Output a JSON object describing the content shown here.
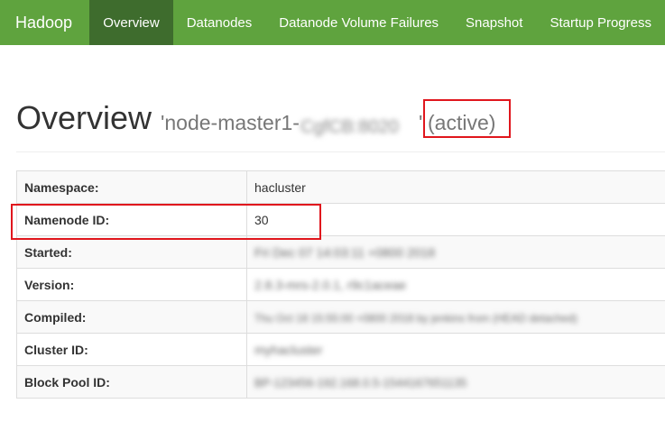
{
  "navbar": {
    "brand": "Hadoop",
    "tabs": [
      {
        "label": "Overview",
        "active": true
      },
      {
        "label": "Datanodes",
        "active": false
      },
      {
        "label": "Datanode Volume Failures",
        "active": false
      },
      {
        "label": "Snapshot",
        "active": false
      },
      {
        "label": "Startup Progress",
        "active": false
      }
    ]
  },
  "header": {
    "title": "Overview",
    "host_prefix": "'node-master1-",
    "host_redacted": "CgfCB:8020",
    "host_suffix": "'",
    "state": "(active)"
  },
  "info_table": {
    "rows": [
      {
        "key": "Namespace:",
        "value": "hacluster",
        "redacted": false
      },
      {
        "key": "Namenode ID:",
        "value": "30",
        "redacted": false
      },
      {
        "key": "Started:",
        "value": "Fri Dec 07 14:03:11 +0800 2018",
        "redacted": true
      },
      {
        "key": "Version:",
        "value": "2.8.3-mrs-2.0.1, r9c1aceae",
        "redacted": true
      },
      {
        "key": "Compiled:",
        "value": "Thu Oct 18 15:55:00 +0800 2018 by jenkins from (HEAD detached)",
        "redacted": true
      },
      {
        "key": "Cluster ID:",
        "value": "myhacluster",
        "redacted": true
      },
      {
        "key": "Block Pool ID:",
        "value": "BP-123456-192.168.0.5-1544167651135",
        "redacted": true
      }
    ]
  },
  "colors": {
    "navbar": "#5fa33e",
    "navbar_active": "#3e6c2d",
    "annotation": "#e0161d"
  }
}
